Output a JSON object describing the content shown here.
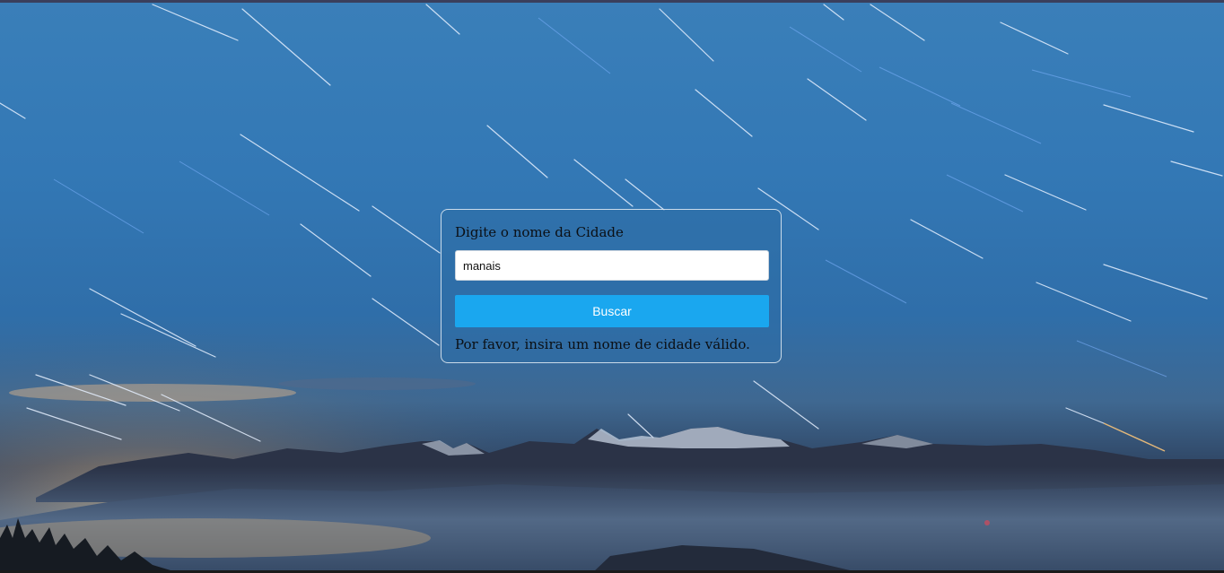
{
  "form": {
    "label": "Digite o nome da Cidade",
    "input_value": "manais",
    "input_placeholder": "",
    "button_label": "Buscar",
    "message": "Por favor, insira um nome de cidade válido."
  },
  "colors": {
    "button": "#1aa7ef",
    "card_border": "#ffffff",
    "sky": "#3378b5"
  },
  "background": {
    "subject": "star-trails-night-sky-over-mountains"
  }
}
